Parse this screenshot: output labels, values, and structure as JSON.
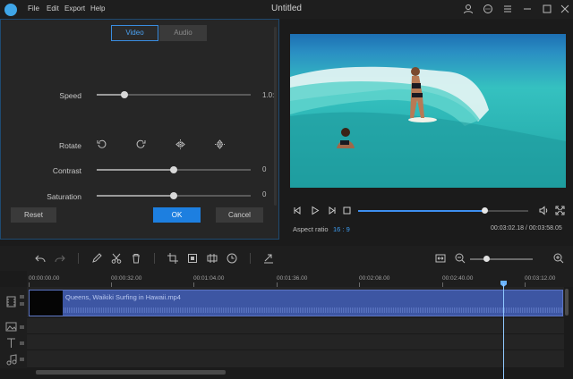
{
  "app": {
    "title": "Untitled",
    "menu": [
      "File",
      "Edit",
      "Export",
      "Help"
    ]
  },
  "edit_panel": {
    "tabs": [
      {
        "label": "Video",
        "active": true
      },
      {
        "label": "Audio",
        "active": false
      }
    ],
    "speed": {
      "label": "Speed",
      "value": "1.0:"
    },
    "rotate": {
      "label": "Rotate",
      "icons": [
        "rotate-left-icon",
        "rotate-right-icon",
        "flip-horizontal-icon",
        "flip-vertical-icon"
      ]
    },
    "contrast": {
      "label": "Contrast",
      "value": "0"
    },
    "saturation": {
      "label": "Saturation",
      "value": "0"
    },
    "buttons": {
      "reset": "Reset",
      "ok": "OK",
      "cancel": "Cancel"
    }
  },
  "preview": {
    "aspect_label": "Aspect ratio",
    "aspect_value": "16 : 9",
    "time": "00:03:02.18 / 00:03:58.05",
    "seek_progress": 0.74
  },
  "timeline": {
    "ruler": [
      "00:00:00.00",
      "00:00:32.00",
      "00:01:04.00",
      "00:01:36.00",
      "00:02:08.00",
      "00:02:40.00",
      "00:03:12.00"
    ],
    "clip_name": "Queens, Waikiki  Surfing in Hawaii.mp4",
    "zoom_level": 0.25
  },
  "colors": {
    "accent": "#1d7fe0",
    "clip": "#3d56a3",
    "playhead": "#6ab3ff"
  }
}
